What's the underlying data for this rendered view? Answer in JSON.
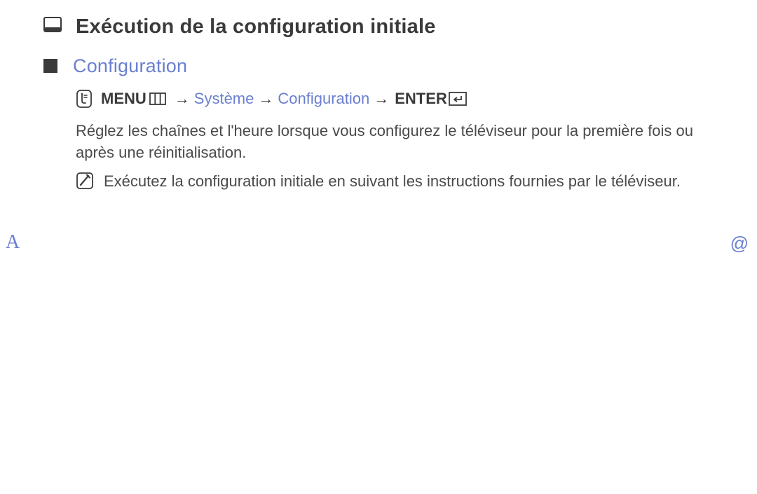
{
  "title": "Exécution de la configuration initiale",
  "section": "Configuration",
  "nav": {
    "menu": "MENU",
    "arrow": "→",
    "path1": "Système",
    "path2": "Configuration",
    "enter": "ENTER"
  },
  "body": "Réglez les chaînes et l'heure lorsque vous configurez le téléviseur pour la première fois ou après une réinitialisation.",
  "note": "Exécutez la configuration initiale en suivant les instructions fournies par le téléviseur.",
  "sideA": "A",
  "sideAt": "@"
}
